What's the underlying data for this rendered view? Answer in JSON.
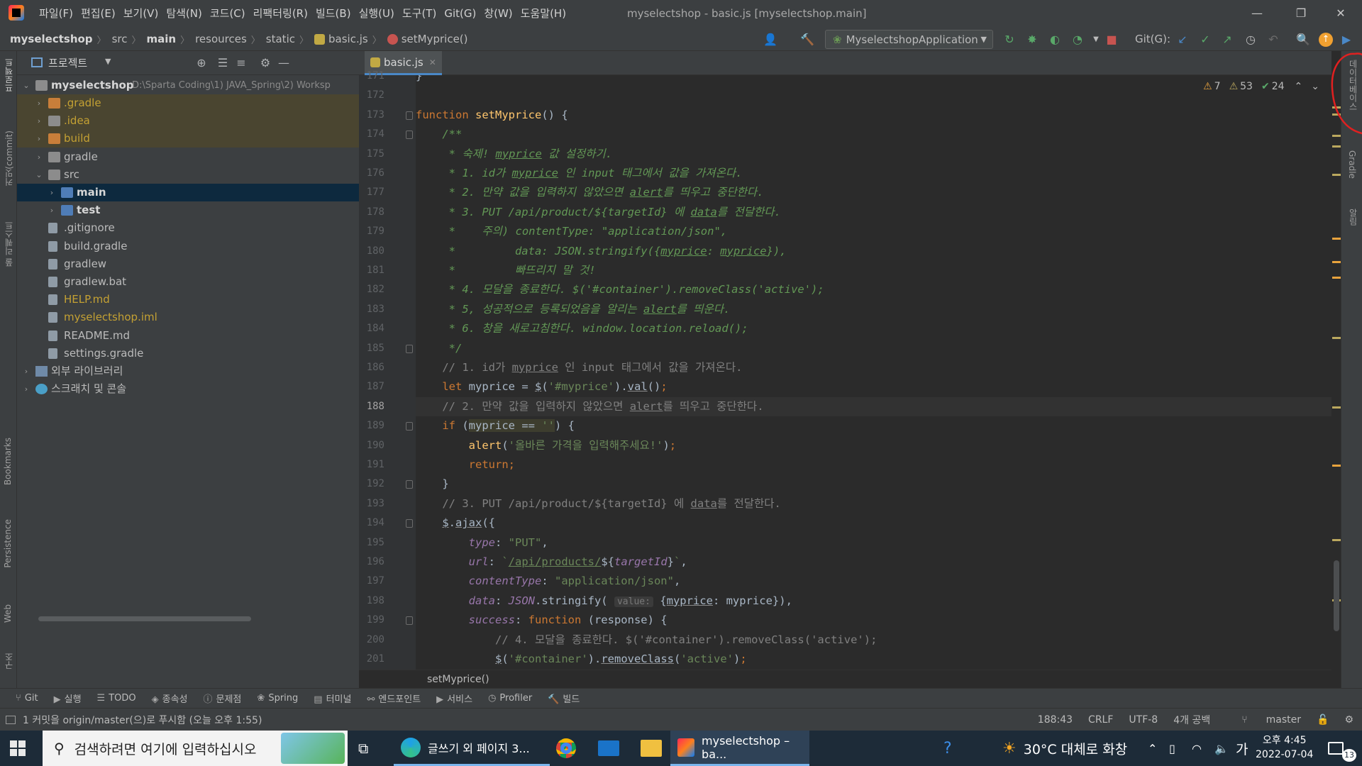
{
  "titlebar": {
    "menu": [
      "파일(F)",
      "편집(E)",
      "보기(V)",
      "탐색(N)",
      "코드(C)",
      "리팩터링(R)",
      "빌드(B)",
      "실행(U)",
      "도구(T)",
      "Git(G)",
      "창(W)",
      "도움말(H)"
    ],
    "title": "myselectshop - basic.js [myselectshop.main]"
  },
  "navbar": {
    "crumbs": [
      "myselectshop",
      "src",
      "main",
      "resources",
      "static",
      "basic.js",
      "setMyprice()"
    ],
    "run_config": "MyselectshopApplication",
    "git_label": "Git(G):"
  },
  "leftstrip": [
    "프로젝트",
    "커밋(commit)",
    "풀 리퀘스트",
    "Bookmarks",
    "Persistence",
    "Web",
    "구조"
  ],
  "rightstrip": [
    "데이터베이스",
    "Gradle",
    "알림"
  ],
  "project": {
    "header": "프로젝트",
    "root_name": "myselectshop",
    "root_path": "D:\\Sparta Coding\\1) JAVA_Spring\\2) Worksp",
    "items": [
      {
        "label": ".gradle",
        "depth": 1,
        "arrow": "›",
        "kind": "folder-orange",
        "style": "excluded"
      },
      {
        "label": ".idea",
        "depth": 1,
        "arrow": "›",
        "kind": "folder",
        "style": "excluded"
      },
      {
        "label": "build",
        "depth": 1,
        "arrow": "›",
        "kind": "folder-orange",
        "style": "excluded"
      },
      {
        "label": "gradle",
        "depth": 1,
        "arrow": "›",
        "kind": "folder",
        "style": ""
      },
      {
        "label": "src",
        "depth": 1,
        "arrow": "⌄",
        "kind": "folder",
        "style": ""
      },
      {
        "label": "main",
        "depth": 2,
        "arrow": "›",
        "kind": "folder-blue",
        "style": "bold",
        "selected": true
      },
      {
        "label": "test",
        "depth": 2,
        "arrow": "›",
        "kind": "folder-blue",
        "style": "bold"
      },
      {
        "label": ".gitignore",
        "depth": 1,
        "arrow": "",
        "kind": "file",
        "style": ""
      },
      {
        "label": "build.gradle",
        "depth": 1,
        "arrow": "",
        "kind": "file",
        "style": ""
      },
      {
        "label": "gradlew",
        "depth": 1,
        "arrow": "",
        "kind": "file",
        "style": ""
      },
      {
        "label": "gradlew.bat",
        "depth": 1,
        "arrow": "",
        "kind": "file",
        "style": ""
      },
      {
        "label": "HELP.md",
        "depth": 1,
        "arrow": "",
        "kind": "file",
        "style": "excluded"
      },
      {
        "label": "myselectshop.iml",
        "depth": 1,
        "arrow": "",
        "kind": "file",
        "style": "excluded"
      },
      {
        "label": "README.md",
        "depth": 1,
        "arrow": "",
        "kind": "file",
        "style": ""
      },
      {
        "label": "settings.gradle",
        "depth": 1,
        "arrow": "",
        "kind": "file",
        "style": ""
      },
      {
        "label": "외부 라이브러리",
        "depth": 0,
        "arrow": "›",
        "kind": "lib",
        "style": ""
      },
      {
        "label": "스크래치 및 콘솔",
        "depth": 0,
        "arrow": "›",
        "kind": "scratch",
        "style": ""
      }
    ]
  },
  "editor": {
    "tab": "basic.js",
    "inspections": {
      "errors": "7",
      "warnings": "53",
      "ok": "24"
    },
    "breadcrumb": "setMyprice()",
    "lines": [
      {
        "n": "171",
        "html": "}"
      },
      {
        "n": "172",
        "html": ""
      },
      {
        "n": "173",
        "html": "<span class='kw'>function</span> <span class='fn'>setMyprice</span>() {"
      },
      {
        "n": "174",
        "html": "    <span class='doc'>/**</span>"
      },
      {
        "n": "175",
        "html": "<span class='doc'>     * 숙제! <u>myprice</u> 값 설정하기.</span>"
      },
      {
        "n": "176",
        "html": "<span class='doc'>     * 1. id가 <u>myprice</u> 인 input 태그에서 값을 가져온다.</span>"
      },
      {
        "n": "177",
        "html": "<span class='doc'>     * 2. 만약 값을 입력하지 않았으면 <u>alert</u>를 띄우고 중단한다.</span>"
      },
      {
        "n": "178",
        "html": "<span class='doc'>     * 3. PUT /api/product/${targetId} 에 <u>data</u>를 전달한다.</span>"
      },
      {
        "n": "179",
        "html": "<span class='doc'>     *    주의) contentType: \"application/json\",</span>"
      },
      {
        "n": "180",
        "html": "<span class='doc'>     *         data: JSON.stringify({<u>myprice</u>: <u>myprice</u>}),</span>"
      },
      {
        "n": "181",
        "html": "<span class='doc'>     *         빠뜨리지 말 것!</span>"
      },
      {
        "n": "182",
        "html": "<span class='doc'>     * 4. 모달을 종료한다. $('#container').removeClass('active');</span>"
      },
      {
        "n": "183",
        "html": "<span class='doc'>     * 5, 성공적으로 등록되었음을 알리는 <u>alert</u>를 띄운다.</span>"
      },
      {
        "n": "184",
        "html": "<span class='doc'>     * 6. 창을 새로고침한다. window.location.reload();</span>"
      },
      {
        "n": "185",
        "html": "<span class='doc'>     */</span>"
      },
      {
        "n": "186",
        "html": "    <span class='cm'>// 1. id가 <u>myprice</u> 인 input 태그에서 값을 가져온다.</span>"
      },
      {
        "n": "187",
        "html": "    <span class='kw'>let</span> myprice = <span class='ul'>$</span>(<span class='str'>'#myprice'</span>).<span class='ul'>val</span>()<span class='kw'>;</span>"
      },
      {
        "n": "188",
        "html": "    <span class='cm'>// 2. 만약 값을 입력하지 않았으면 <u>alert</u>를 띄우고 중단한다.</span>",
        "current": true
      },
      {
        "n": "189",
        "html": "    <span class='kw'>if</span> (<span style='background:#3d3d2e'>myprice == <span class='str'>''</span></span>) {"
      },
      {
        "n": "190",
        "html": "        <span class='fn'>alert</span>(<span class='str'>'올바른 가격을 입력해주세요!'</span>)<span class='kw'>;</span>"
      },
      {
        "n": "191",
        "html": "        <span class='kw'>return;</span>"
      },
      {
        "n": "192",
        "html": "    }"
      },
      {
        "n": "193",
        "html": "    <span class='cm'>// 3. PUT /api/product/${targetId} 에 <u>data</u>를 전달한다.</span>"
      },
      {
        "n": "194",
        "html": "    <span class='ul'>$</span>.<span class='ul'>ajax</span>({"
      },
      {
        "n": "195",
        "html": "        <span class='glob'>type</span>: <span class='str'>\"PUT\"</span>,"
      },
      {
        "n": "196",
        "html": "        <span class='glob'>url</span>: <span class='str'>`<u>/api/products/</u></span>${<span class='glob'>targetId</span>}<span class='str'>`</span>,"
      },
      {
        "n": "197",
        "html": "        <span class='glob'>contentType</span>: <span class='str'>\"application/json\"</span>,"
      },
      {
        "n": "198",
        "html": "        <span class='glob'>data</span>: <span class='glob'>JSON</span>.stringify( <span class='hint'>value:</span> {<span class='ul'>myprice</span>: myprice}),"
      },
      {
        "n": "199",
        "html": "        <span class='glob'>success</span>: <span class='kw'>function</span> (response) {"
      },
      {
        "n": "200",
        "html": "            <span class='cm'>// 4. 모달을 종료한다. $('#container').removeClass('active');</span>"
      },
      {
        "n": "201",
        "html": "            <span class='ul'>$</span>(<span class='str'>'#container'</span>).<span class='ul'>removeClass</span>(<span class='str'>'active'</span>)<span class='kw'>;</span>"
      }
    ]
  },
  "toolwindows": [
    "Git",
    "실행",
    "TODO",
    "종속성",
    "문제점",
    "Spring",
    "터미널",
    "엔드포인트",
    "서비스",
    "Profiler",
    "빌드"
  ],
  "status": {
    "message": "1 커밋을 origin/master(으)로 푸시함 (오늘 오후 1:55)",
    "position": "188:43",
    "line_sep": "CRLF",
    "encoding": "UTF-8",
    "indent": "4개 공백",
    "branch": "master"
  },
  "taskbar": {
    "search_placeholder": "검색하려면 여기에 입력하십시오",
    "apps": [
      "글쓰기 외 페이지 3...",
      "myselectshop – ba..."
    ],
    "weather": "30°C 대체로 화창",
    "ime": "가",
    "time": "오후 4:45",
    "date": "2022-07-04",
    "notif_count": "13"
  },
  "colors": {
    "accent": "#4a88c7",
    "selection": "#0d293e",
    "annotation": "#e02020"
  }
}
